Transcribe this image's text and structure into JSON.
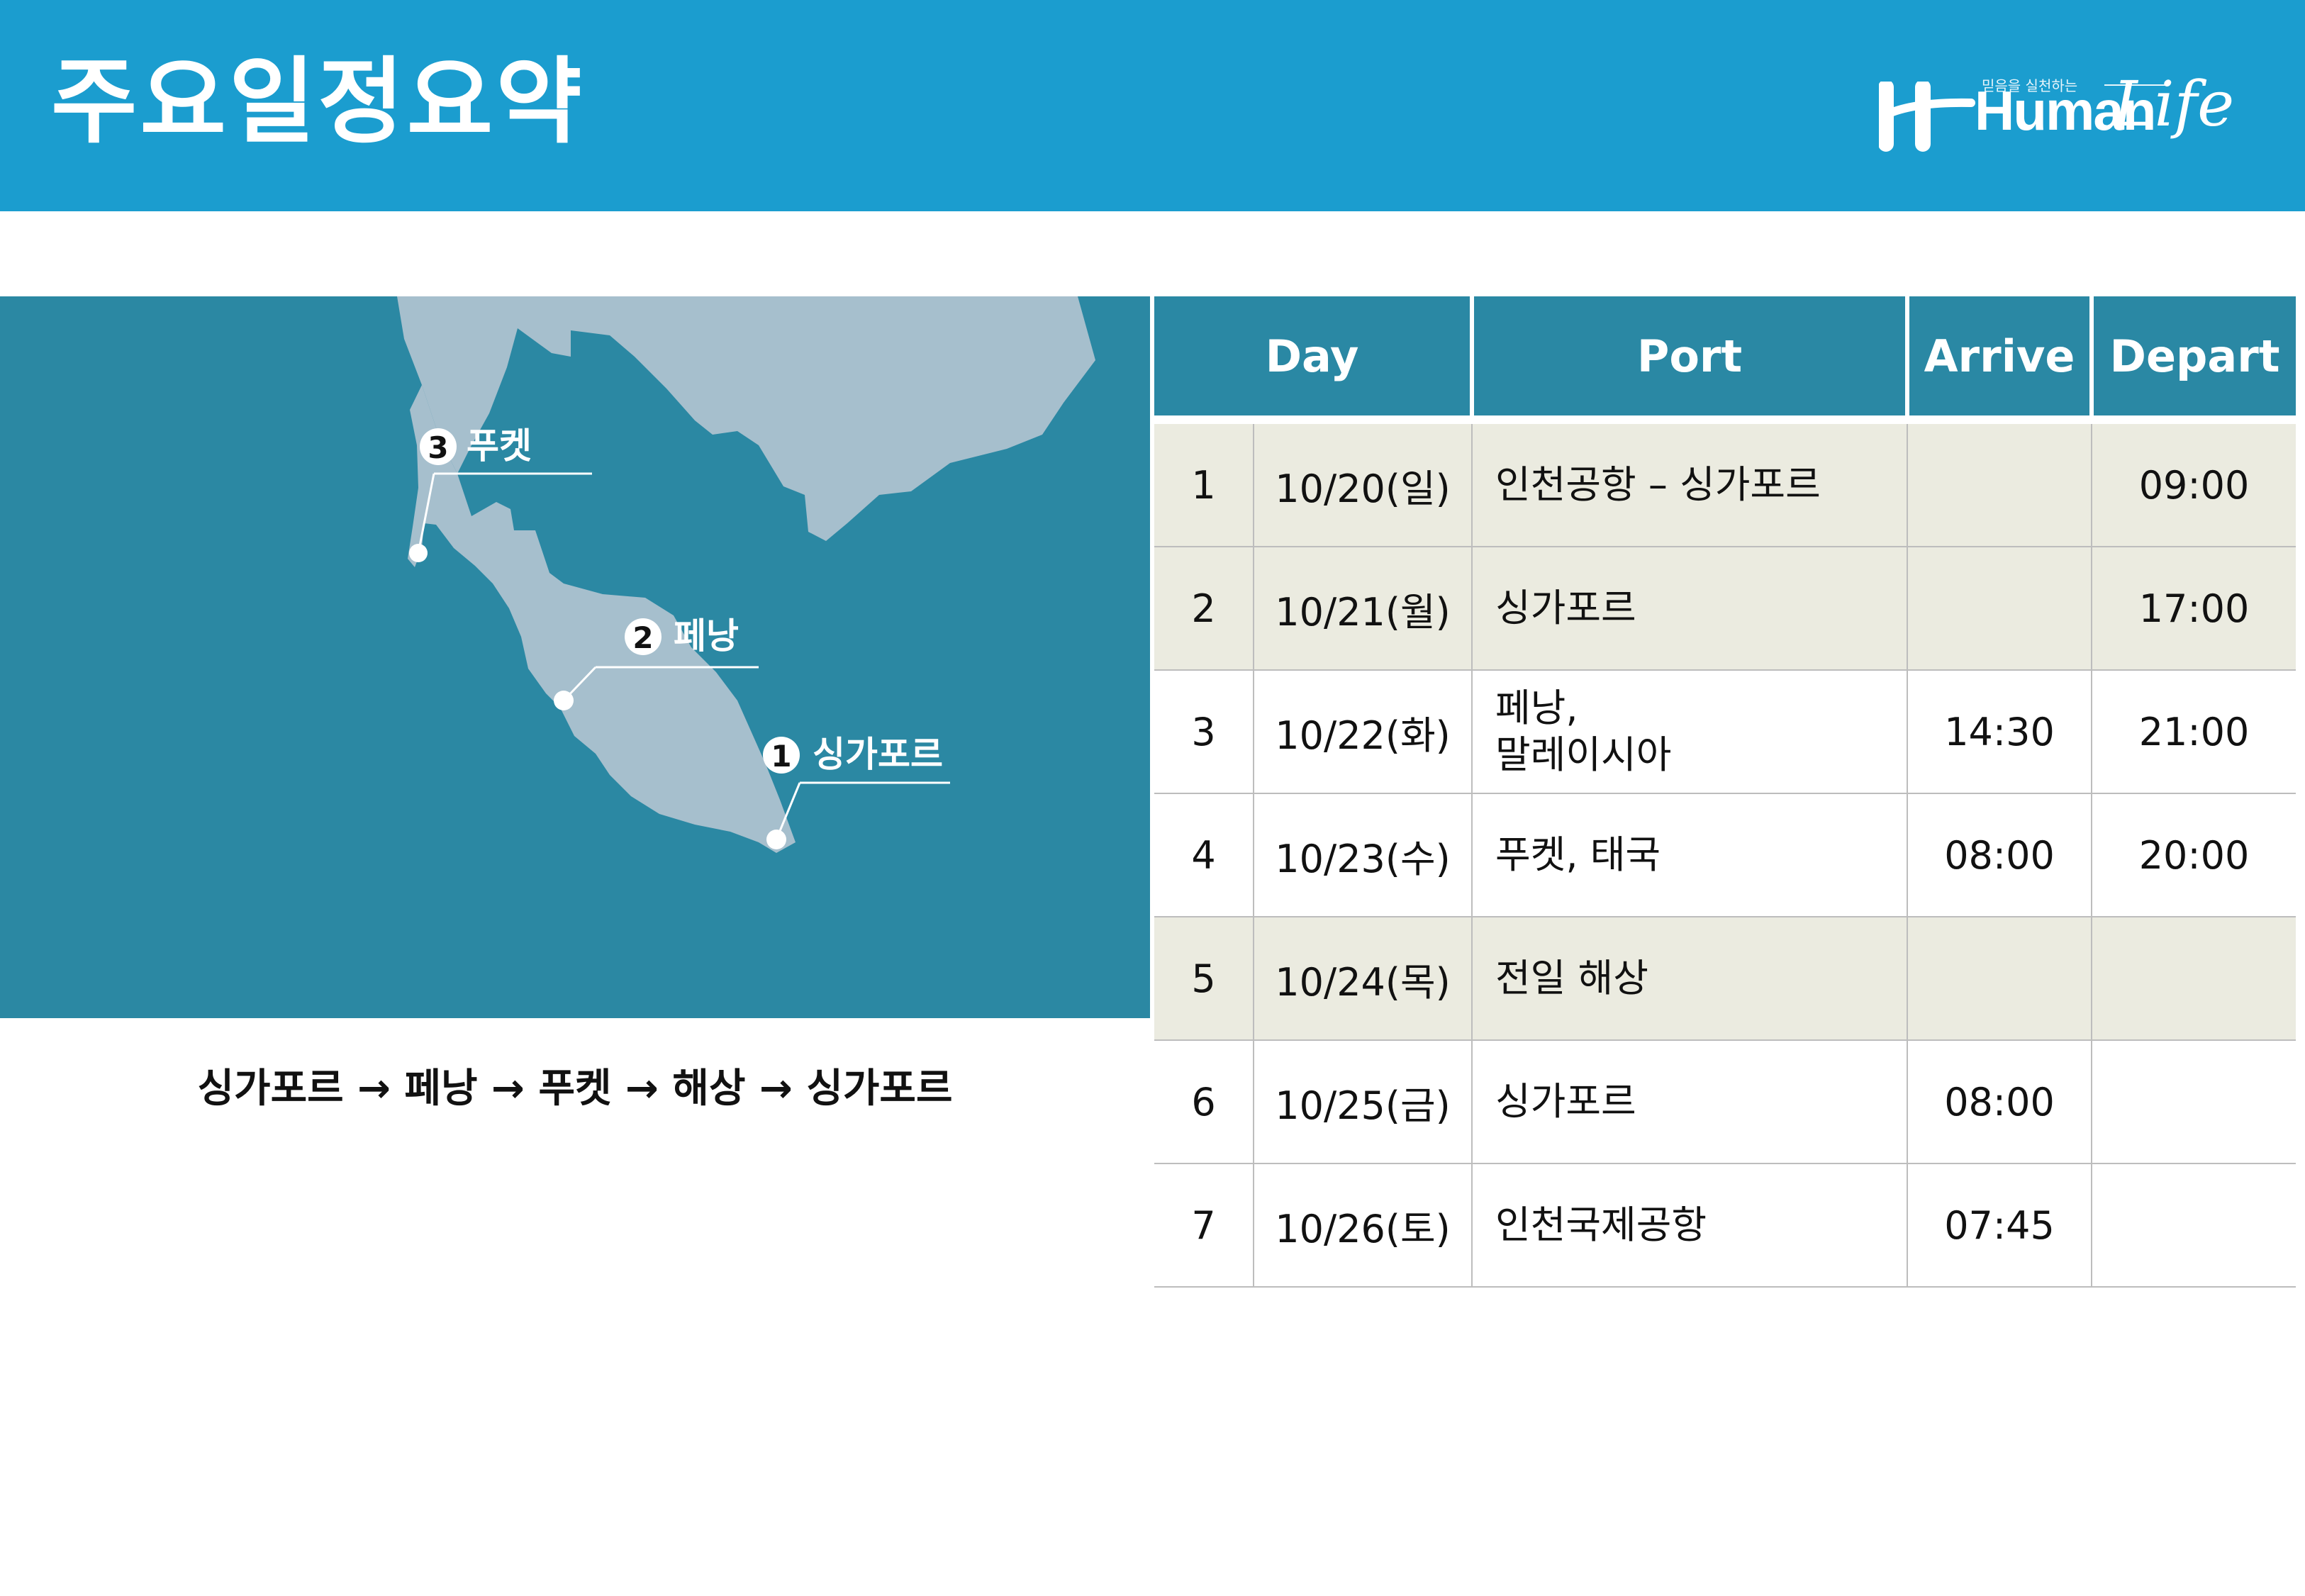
{
  "header": {
    "title": "주요일정요약",
    "logo": {
      "tagline": "믿음을 실천하는",
      "brand_word": "Human",
      "brand_script": "Life"
    }
  },
  "colors": {
    "header_bg": "#1b9dcf",
    "sea": "#2b88a3",
    "land": "#a6bfcd",
    "table_header": "#2a88a4",
    "row_shade": "#ebebe0"
  },
  "map": {
    "markers": [
      {
        "number": "3",
        "label": "푸켓"
      },
      {
        "number": "2",
        "label": "페낭"
      },
      {
        "number": "1",
        "label": "싱가포르"
      }
    ]
  },
  "route": "싱가포르 → 페낭 → 푸켓 → 해상 → 싱가포르",
  "schedule": {
    "headers": {
      "day": "Day",
      "port": "Port",
      "arrive": "Arrive",
      "depart": "Depart"
    },
    "rows": [
      {
        "day": "1",
        "date": "10/20(일)",
        "port": [
          "인천공항 – 싱가포르"
        ],
        "arrive": "",
        "depart": "09:00",
        "shaded": true
      },
      {
        "day": "2",
        "date": "10/21(월)",
        "port": [
          "싱가포르"
        ],
        "arrive": "",
        "depart": "17:00",
        "shaded": true
      },
      {
        "day": "3",
        "date": "10/22(화)",
        "port": [
          "페낭,",
          "말레이시아"
        ],
        "arrive": "14:30",
        "depart": "21:00",
        "shaded": false
      },
      {
        "day": "4",
        "date": "10/23(수)",
        "port": [
          "푸켓, 태국"
        ],
        "arrive": "08:00",
        "depart": "20:00",
        "shaded": false
      },
      {
        "day": "5",
        "date": "10/24(목)",
        "port": [
          "전일 해상"
        ],
        "arrive": "",
        "depart": "",
        "shaded": true
      },
      {
        "day": "6",
        "date": "10/25(금)",
        "port": [
          "싱가포르"
        ],
        "arrive": "08:00",
        "depart": "",
        "shaded": false
      },
      {
        "day": "7",
        "date": "10/26(토)",
        "port": [
          "인천국제공항"
        ],
        "arrive": "07:45",
        "depart": "",
        "shaded": false
      }
    ]
  }
}
